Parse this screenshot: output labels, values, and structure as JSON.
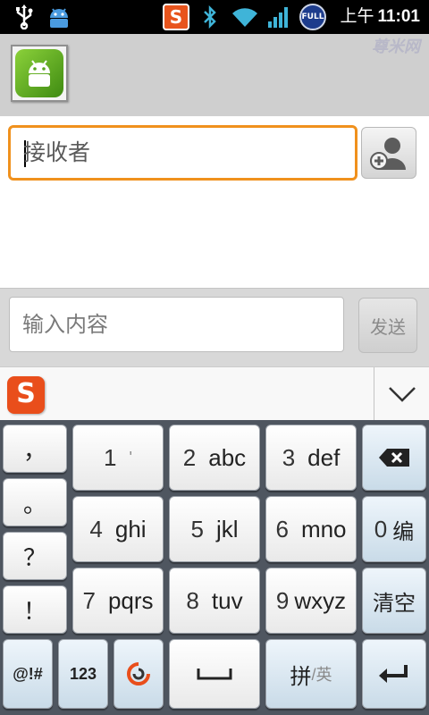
{
  "status_bar": {
    "ampm": "上午",
    "time": "11:01",
    "icons": [
      "usb-icon",
      "android-debug-icon",
      "sogou-ime-icon",
      "bluetooth-icon",
      "wifi-icon",
      "signal-icon",
      "full-battery-icon"
    ],
    "sogou_letter": "S",
    "full_badge": "FULL"
  },
  "watermark": "尊米网",
  "compose": {
    "recipient_placeholder": "接收者",
    "message_placeholder": "输入内容",
    "send_label": "发送"
  },
  "ime": {
    "logo_letter": "S",
    "keys": {
      "comma": "，",
      "period": "。",
      "question": "？",
      "exclaim": "！",
      "k1_num": "1",
      "k1_sym": "'",
      "k2_num": "2",
      "k2_letters": "abc",
      "k3_num": "3",
      "k3_letters": "def",
      "k4_num": "4",
      "k4_letters": "ghi",
      "k5_num": "5",
      "k5_letters": "jkl",
      "k6_num": "6",
      "k6_letters": "mno",
      "k0_num": "0",
      "k0_label": "编",
      "k7_num": "7",
      "k7_letters": "pqrs",
      "k8_num": "8",
      "k8_letters": "tuv",
      "k9_num": "9",
      "k9_letters": "wxyz",
      "clear": "清空",
      "symbols": "@!#",
      "numbers": "123",
      "pinyin": "拼",
      "english": "/英"
    }
  }
}
